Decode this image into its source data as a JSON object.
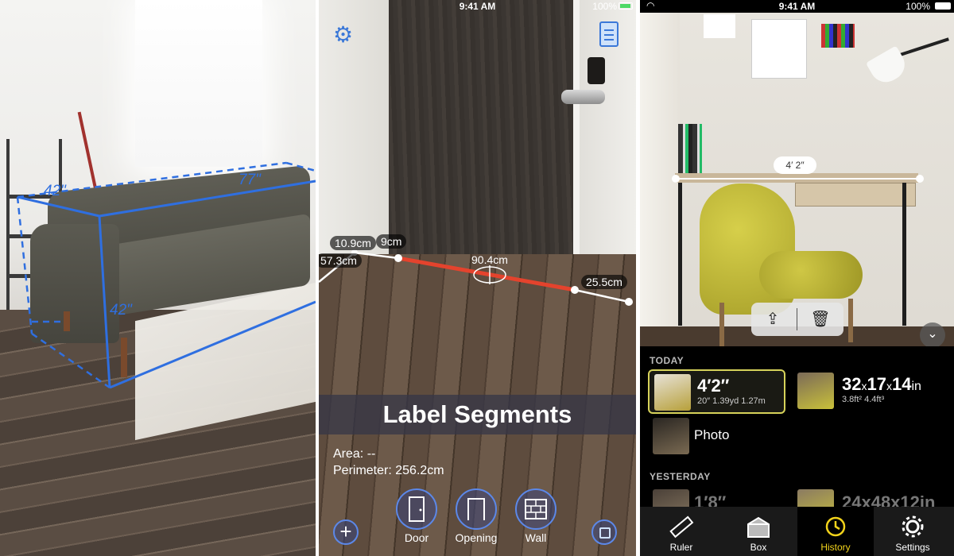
{
  "panel_sofa": {
    "dims": {
      "width": "77\"",
      "depth": "42\"",
      "height": "42\""
    }
  },
  "panel_door": {
    "status": {
      "time": "9:41 AM",
      "battery": "100%"
    },
    "segments": [
      "10.9cm",
      "9cm",
      "57.3cm",
      "90.4cm",
      "25.5cm"
    ],
    "banner": "Label Segments",
    "area": "Area: --",
    "perimeter": "Perimeter: 256.2cm",
    "tools": [
      "Door",
      "Opening",
      "Wall"
    ],
    "colors": {
      "accent": "#5c88e8",
      "segment_active": "#e4432d"
    }
  },
  "panel_history": {
    "status": {
      "time": "9:41 AM",
      "battery": "100%"
    },
    "measure_pill": "4′ 2″",
    "sections": {
      "today": "TODAY",
      "yesterday": "YESTERDAY"
    },
    "today_items": [
      {
        "main": "4′2″",
        "sub": "20″  1.39yd  1.27m"
      },
      {
        "main_a": "32",
        "main_x1": "x",
        "main_b": "17",
        "main_x2": "x",
        "main_c": "14",
        "unit": "in",
        "sub": "3.8ft²  4.4ft³"
      },
      {
        "main": "Photo"
      }
    ],
    "yesterday_items": [
      {
        "main": "1′8″"
      },
      {
        "main": "24x48x12in"
      }
    ],
    "tabs": [
      "Ruler",
      "Box",
      "History",
      "Settings"
    ],
    "colors": {
      "active_tab": "#f2d31b",
      "card_border": "#d6d25a"
    }
  }
}
